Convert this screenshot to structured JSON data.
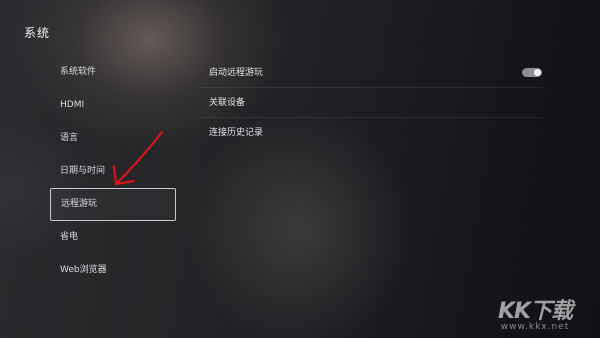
{
  "header": {
    "title": "系统"
  },
  "sidebar": {
    "items": [
      {
        "label": "系统软件",
        "active": false
      },
      {
        "label": "HDMI",
        "active": false
      },
      {
        "label": "语言",
        "active": false
      },
      {
        "label": "日期与时间",
        "active": false
      },
      {
        "label": "远程游玩",
        "active": true
      },
      {
        "label": "省电",
        "active": false
      },
      {
        "label": "Web浏览器",
        "active": false
      }
    ]
  },
  "main": {
    "settings": [
      {
        "label": "启动远程游玩",
        "toggle": "on"
      },
      {
        "label": "关联设备"
      },
      {
        "label": "连接历史记录"
      }
    ]
  },
  "annotation": {
    "arrow_color": "#d8141b"
  },
  "watermark": {
    "logo": "KK下载",
    "url": "www.kkx.net"
  },
  "colors": {
    "background": "#1e1f23",
    "toggle_track": "#8e8e95",
    "toggle_knob": "#f4f4f6",
    "selection_border": "#c9c9cf"
  }
}
